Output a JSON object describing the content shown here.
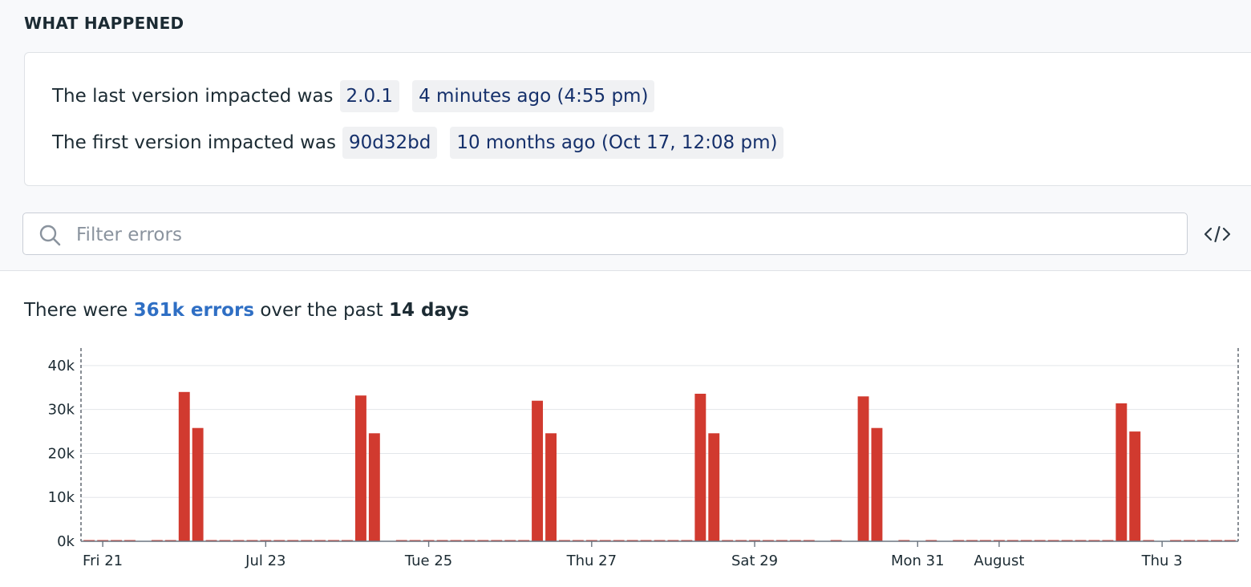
{
  "section": {
    "title": "WHAT HAPPENED"
  },
  "versions": {
    "last": {
      "prefix": "The last version impacted was",
      "version": "2.0.1",
      "when": "4 minutes ago (4:55 pm)"
    },
    "first": {
      "prefix": "The first version impacted was",
      "version": "90d32bd",
      "when": "10 months ago (Oct 17, 12:08 pm)"
    }
  },
  "filter": {
    "placeholder": "Filter errors"
  },
  "icons": {
    "search": "search-icon",
    "code": "code-icon"
  },
  "summary": {
    "pre": "There were",
    "count": "361k errors",
    "mid": "over the past",
    "period": "14 days"
  },
  "colors": {
    "bar": "#d13a2f",
    "link": "#2f6fc4",
    "chip_bg": "#f0f1f3",
    "chip_text": "#15306b"
  },
  "chart_data": {
    "type": "bar",
    "ylim": [
      0,
      44000
    ],
    "y_ticks": [
      0,
      10000,
      20000,
      30000,
      40000
    ],
    "y_tick_labels": [
      "0k",
      "10k",
      "20k",
      "30k",
      "40k"
    ],
    "x_tick_labels": [
      "Fri 21",
      "Jul 23",
      "Tue 25",
      "Thu 27",
      "Sat 29",
      "Mon 31",
      "August",
      "Thu 3"
    ],
    "x_tick_positions": [
      1,
      13,
      25,
      37,
      49,
      61,
      67,
      79
    ],
    "grid": true,
    "series": [
      {
        "values": [
          200,
          200,
          200,
          200,
          0,
          200,
          200,
          34000,
          25800,
          200,
          200,
          200,
          200,
          200,
          200,
          200,
          200,
          200,
          200,
          200,
          33200,
          24600,
          0,
          200,
          200,
          200,
          200,
          200,
          200,
          200,
          200,
          200,
          200,
          32000,
          24600,
          200,
          200,
          200,
          200,
          200,
          200,
          200,
          200,
          200,
          200,
          33600,
          24600,
          200,
          200,
          200,
          200,
          200,
          200,
          200,
          0,
          200,
          0,
          33000,
          25800,
          0,
          200,
          0,
          200,
          0,
          200,
          200,
          200,
          200,
          200,
          200,
          200,
          200,
          200,
          200,
          200,
          200,
          31400,
          25000,
          200,
          0,
          200,
          200,
          200,
          200,
          200
        ]
      }
    ]
  }
}
